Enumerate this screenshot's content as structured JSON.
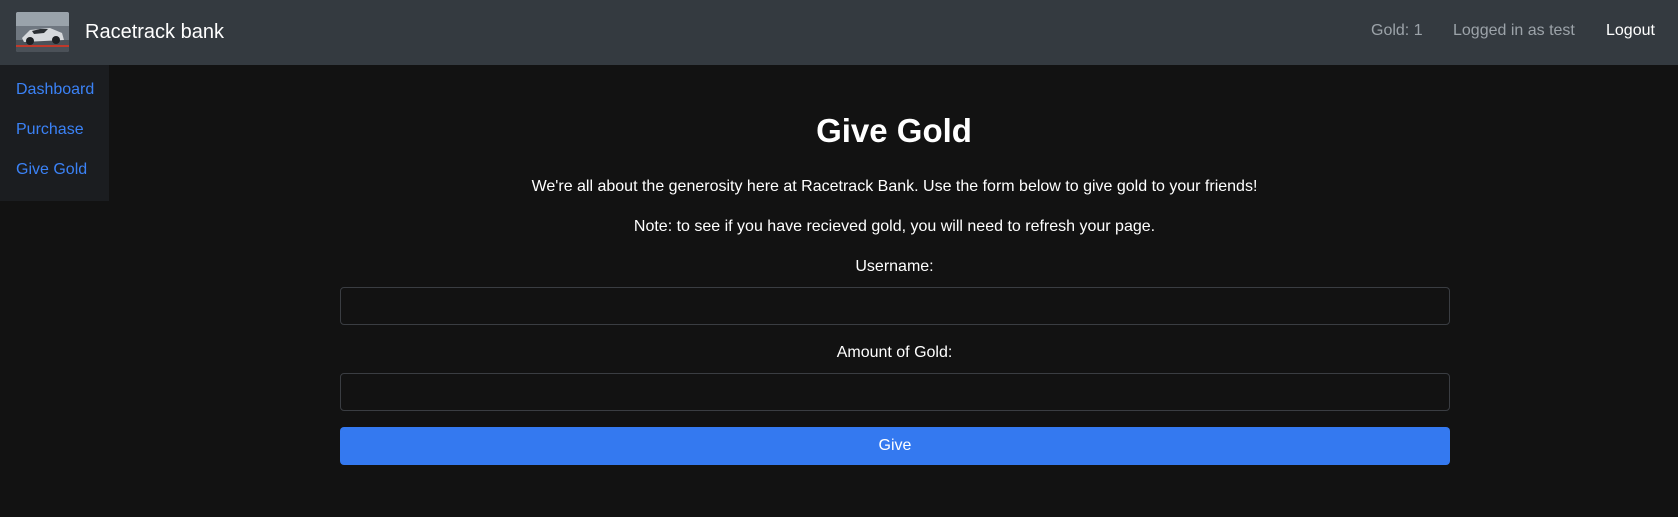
{
  "navbar": {
    "brand_name": "Racetrack bank",
    "gold": "Gold: 1",
    "user": "Logged in as test",
    "logout": "Logout"
  },
  "sidebar": {
    "items": [
      {
        "label": "Dashboard"
      },
      {
        "label": "Purchase"
      },
      {
        "label": "Give Gold"
      }
    ]
  },
  "main": {
    "title": "Give Gold",
    "intro": "We're all about the generosity here at Racetrack Bank. Use the form below to give gold to your friends!",
    "note": "Note: to see if you have recieved gold, you will need to refresh your page.",
    "username_label": "Username:",
    "username_value": "",
    "amount_label": "Amount of Gold:",
    "amount_value": "",
    "submit_label": "Give"
  },
  "colors": {
    "navbar_bg": "#343a40",
    "page_bg": "#121212",
    "link": "#3b82f6",
    "button": "#3479f0"
  }
}
